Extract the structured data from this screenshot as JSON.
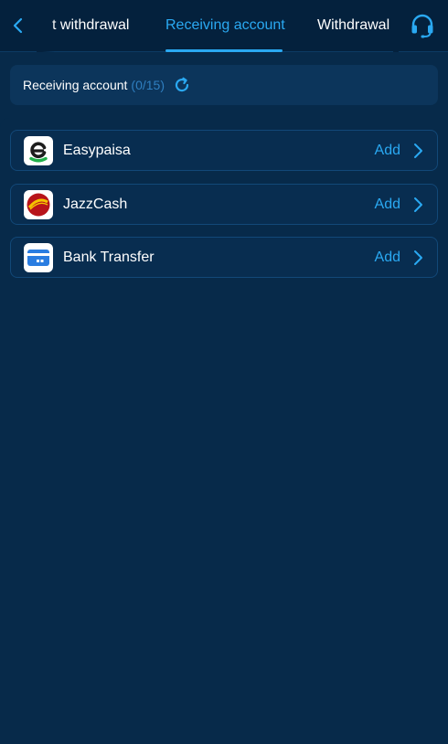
{
  "header": {
    "tabs": [
      {
        "label": "t withdrawal"
      },
      {
        "label": "Receiving account"
      },
      {
        "label": "Withdrawal l"
      }
    ],
    "active_tab": 1
  },
  "summary": {
    "label": "Receiving account",
    "count": "(0/15)"
  },
  "methods": [
    {
      "name": "Easypaisa",
      "action": "Add",
      "icon": "easypaisa-logo"
    },
    {
      "name": "JazzCash",
      "action": "Add",
      "icon": "jazzcash-logo"
    },
    {
      "name": "Bank Transfer",
      "action": "Add",
      "icon": "bank-card-icon"
    }
  ],
  "colors": {
    "accent": "#2aa9f2",
    "background": "#072a4a",
    "header": "#04213d",
    "card": "#0c355b"
  }
}
